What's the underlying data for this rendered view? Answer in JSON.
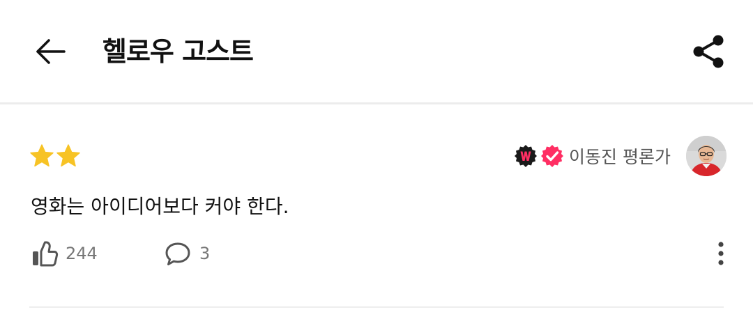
{
  "header": {
    "title": "헬로우 고스트",
    "back_icon": "arrow-left-icon",
    "share_icon": "share-icon"
  },
  "review": {
    "rating": 2,
    "rating_max": 5,
    "star_icon": "star-icon",
    "star_color": "#f7c325",
    "reviewer": {
      "name": "이동진 평론가",
      "badges": [
        "w-badge-icon",
        "verified-badge-icon"
      ],
      "accent_color": "#ff2e63"
    },
    "text": "영화는 아이디어보다 커야 한다.",
    "likes": "244",
    "comments": "3",
    "like_icon": "thumbs-up-icon",
    "comment_icon": "comment-icon",
    "more_icon": "more-vertical-icon"
  }
}
